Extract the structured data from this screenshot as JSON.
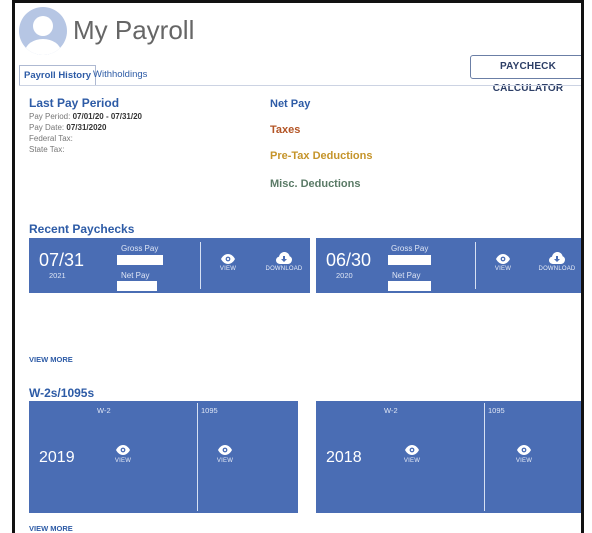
{
  "header": {
    "title": "My Payroll",
    "calculator_button": "PAYCHECK CALCULATOR"
  },
  "tabs": [
    {
      "label": "Payroll History",
      "active": true
    },
    {
      "label": "Withholdings",
      "active": false
    }
  ],
  "last_pay_period": {
    "heading": "Last Pay Period",
    "pay_period_label": "Pay Period:",
    "pay_period_value": "07/01/20 - 07/31/20",
    "pay_date_label": "Pay Date:",
    "pay_date_value": "07/31/2020",
    "federal_tax_label": "Federal Tax:",
    "state_tax_label": "State Tax:"
  },
  "breakdown_legend": [
    {
      "label": "Net Pay",
      "color": "#2d5ba6"
    },
    {
      "label": "Taxes",
      "color": "#b35526"
    },
    {
      "label": "Pre-Tax Deductions",
      "color": "#c5942a"
    },
    {
      "label": "Misc. Deductions",
      "color": "#5a7a66"
    }
  ],
  "recent_paychecks": {
    "heading": "Recent Paychecks",
    "gross_pay_label": "Gross Pay",
    "net_pay_label": "Net Pay",
    "view_label": "VIEW",
    "download_label": "DOWNLOAD",
    "items": [
      {
        "date": "07/31",
        "year": "2021"
      },
      {
        "date": "06/30",
        "year": "2020"
      }
    ],
    "view_more": "VIEW MORE"
  },
  "tax_forms": {
    "heading": "W-2s/1095s",
    "w2_label": "W-2",
    "form_1095_label": "1095",
    "view_label": "VIEW",
    "items": [
      {
        "year": "2019"
      },
      {
        "year": "2018"
      }
    ],
    "view_more": "VIEW MORE"
  },
  "colors": {
    "accent": "#2d5ba6",
    "card": "#4a6db4"
  },
  "icons": {
    "avatar": "user-avatar-icon",
    "view": "eye-icon",
    "download": "cloud-download-icon"
  }
}
